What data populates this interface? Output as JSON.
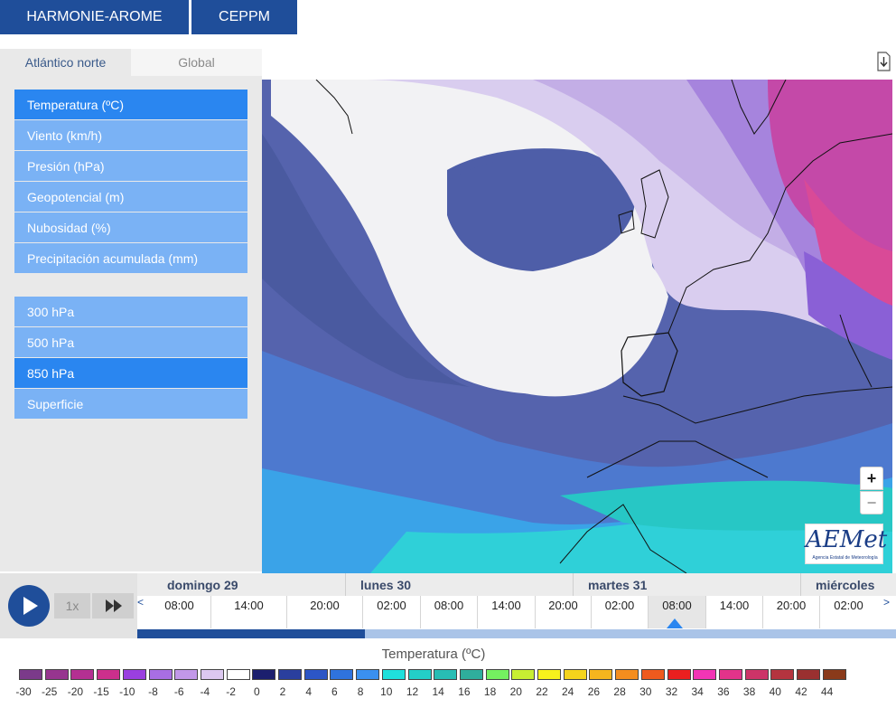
{
  "models": {
    "harmonie": "HARMONIE-AROME",
    "ceppm": "CEPPM"
  },
  "regions": {
    "atlantic": "Atlántico norte",
    "global": "Global"
  },
  "variables": [
    {
      "label": "Temperatura (ºC)",
      "active": true
    },
    {
      "label": "Viento (km/h)",
      "active": false
    },
    {
      "label": "Presión (hPa)",
      "active": false
    },
    {
      "label": "Geopotencial (m)",
      "active": false
    },
    {
      "label": "Nubosidad (%)",
      "active": false
    },
    {
      "label": "Precipitación acumulada (mm)",
      "active": false
    }
  ],
  "levels": [
    {
      "label": "300 hPa",
      "active": false
    },
    {
      "label": "500 hPa",
      "active": false
    },
    {
      "label": "850 hPa",
      "active": true
    },
    {
      "label": "Superficie",
      "active": false
    }
  ],
  "map": {
    "zoom_in": "+",
    "zoom_out": "−",
    "logo": "AEMet",
    "logo_sub": "Agencia Estatal de Meteorología"
  },
  "timeline": {
    "speed": "1x",
    "prev": "<",
    "next": ">",
    "days": [
      "domingo 29",
      "lunes 30",
      "martes 31",
      "miércoles"
    ],
    "hours": [
      "08:00",
      "14:00",
      "20:00",
      "02:00",
      "08:00",
      "14:00",
      "20:00",
      "02:00",
      "08:00",
      "14:00",
      "20:00",
      "02:00"
    ],
    "selected_hour_index": 8,
    "progress_fraction": 0.3
  },
  "legend": {
    "title": "Temperatura (ºC)",
    "ticks": [
      "-30",
      "-25",
      "-20",
      "-15",
      "-10",
      "-8",
      "-6",
      "-4",
      "-2",
      "0",
      "2",
      "4",
      "6",
      "8",
      "10",
      "12",
      "14",
      "16",
      "18",
      "20",
      "22",
      "24",
      "26",
      "28",
      "30",
      "32",
      "34",
      "36",
      "38",
      "40",
      "42",
      "44"
    ],
    "colors": [
      "#7b3a8a",
      "#97358f",
      "#b43092",
      "#cc2f8c",
      "#9a3fe0",
      "#a86ee3",
      "#c298e8",
      "#dcc8f0",
      "#ffffff",
      "#1b1f6e",
      "#2a3f9e",
      "#2c56c6",
      "#2f73de",
      "#3a90f0",
      "#1fe0dc",
      "#23cfc7",
      "#28bdb4",
      "#2fae9c",
      "#74f060",
      "#c8ee32",
      "#f7f21c",
      "#f5d41c",
      "#f5b51e",
      "#f48d1e",
      "#ef5a1e",
      "#ea1f1f",
      "#f235b5",
      "#e2338a",
      "#cc3468",
      "#b4343f",
      "#9a3030",
      "#8a3a1a"
    ]
  }
}
